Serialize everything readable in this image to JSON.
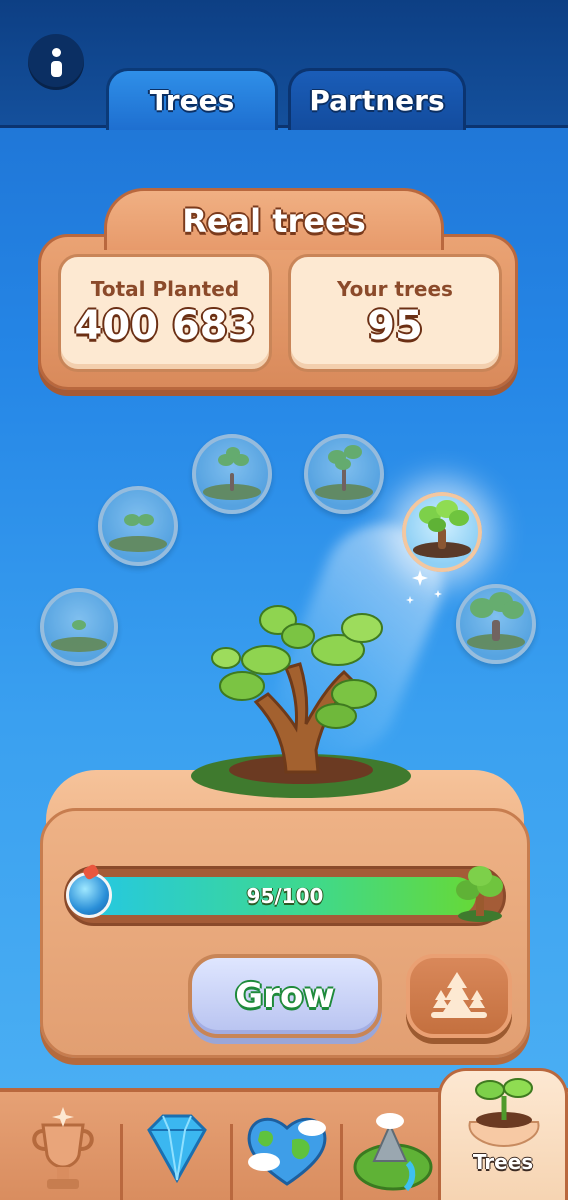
{
  "header": {
    "tabs": [
      {
        "label": "Trees",
        "active": true
      },
      {
        "label": "Partners",
        "active": false
      }
    ],
    "info_icon": "info-icon"
  },
  "stats": {
    "title": "Real trees",
    "total_label": "Total Planted",
    "total_value": "400 683",
    "yours_label": "Your trees",
    "yours_value": "95"
  },
  "growth": {
    "stages_total": 7,
    "current_stage": 5,
    "progress_text": "95/100",
    "progress_fraction": 0.95
  },
  "actions": {
    "grow_label": "Grow",
    "forest_icon": "forest-icon"
  },
  "bottom_nav": {
    "items": [
      {
        "icon": "trophy-icon"
      },
      {
        "icon": "gem-icon"
      },
      {
        "icon": "heart-globe-icon"
      },
      {
        "icon": "island-icon"
      },
      {
        "icon": "sprout-icon",
        "label": "Trees",
        "active": true
      }
    ]
  },
  "colors": {
    "sky": "#2586e6",
    "panel": "#eaa374",
    "progress": "#3fd98b",
    "grow_text_outline": "#1e8a3a"
  }
}
